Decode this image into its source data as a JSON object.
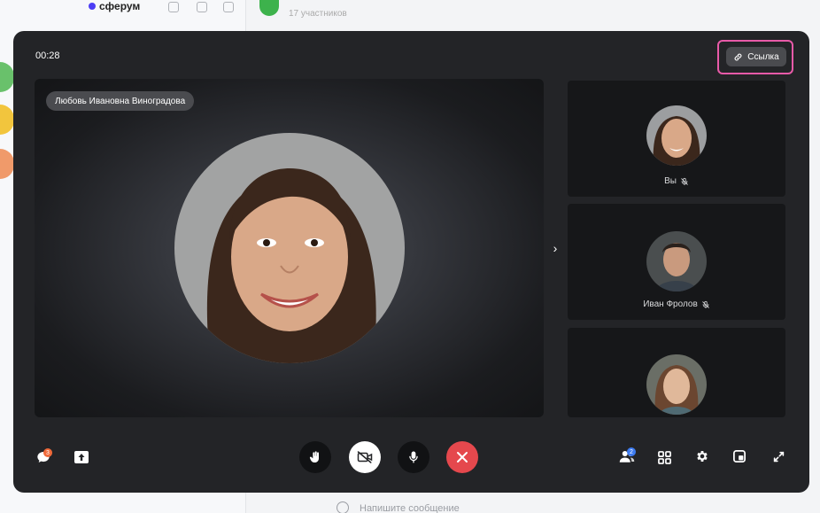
{
  "background": {
    "brand": "сферум",
    "participants": "17 участников",
    "composer_placeholder": "Напишите сообщение"
  },
  "call": {
    "timer": "00:28",
    "link_label": "Ссылка",
    "main_speaker": "Любовь Ивановна Виноградова",
    "participants": [
      {
        "label": "Вы",
        "muted": true
      },
      {
        "label": "Иван Фролов",
        "muted": true
      },
      {
        "label": "",
        "muted": false
      }
    ],
    "chat_badge": "3",
    "people_badge": "2"
  },
  "icons": {
    "link": "link-icon",
    "chat": "chat-icon",
    "share": "share-screen-icon",
    "hand": "raise-hand-icon",
    "camera": "camera-off-icon",
    "mic": "microphone-icon",
    "end": "end-call-icon",
    "people": "participants-icon",
    "grid": "grid-layout-icon",
    "settings": "gear-icon",
    "pip": "picture-in-picture-icon",
    "fullscreen": "fullscreen-icon"
  },
  "colors": {
    "accent_highlight": "#e85aa8",
    "end_call": "#e5484d",
    "window_bg": "#232427",
    "badge_orange": "#f06a3a",
    "badge_blue": "#3d7bf0"
  }
}
